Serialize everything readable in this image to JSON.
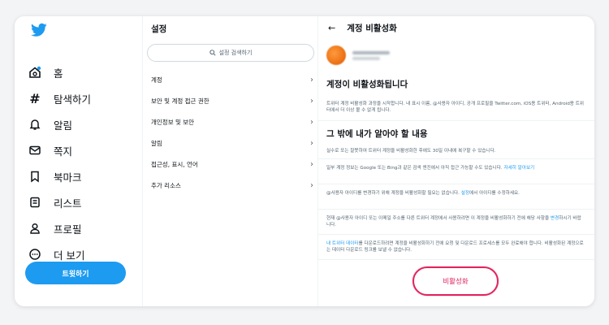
{
  "nav": {
    "items": [
      {
        "name": "home",
        "label": "홈",
        "icon": "home-icon"
      },
      {
        "name": "explore",
        "label": "탐색하기",
        "icon": "hashtag-icon"
      },
      {
        "name": "notifications",
        "label": "알림",
        "icon": "bell-icon"
      },
      {
        "name": "messages",
        "label": "쪽지",
        "icon": "envelope-icon"
      },
      {
        "name": "bookmarks",
        "label": "북마크",
        "icon": "bookmark-icon"
      },
      {
        "name": "lists",
        "label": "리스트",
        "icon": "list-icon"
      },
      {
        "name": "profile",
        "label": "프로필",
        "icon": "person-icon"
      },
      {
        "name": "more",
        "label": "더 보기",
        "icon": "more-icon"
      }
    ],
    "tweet_label": "트윗하기"
  },
  "settings": {
    "title": "설정",
    "search_placeholder": "설정 검색하기",
    "items": [
      {
        "label": "계정"
      },
      {
        "label": "보안 및 계정 접근 권한"
      },
      {
        "label": "개인정보 및 보안"
      },
      {
        "label": "알림"
      },
      {
        "label": "접근성, 표시, 언어"
      },
      {
        "label": "추가 리소스"
      }
    ]
  },
  "detail": {
    "title": "계정 비활성화",
    "heading1": "계정이 비활성화됩니다",
    "para1": "트위터 계정 비활성화 과정을 시작합니다. 내 표시 이름, @사용자 아이디, 공개 프로필을 Twitter.com, iOS용 트위터, Android용 트위터에서 더 이상 볼 수 없게 됩니다.",
    "heading2": "그 밖에 내가 알아야 할 내용",
    "p1": "실수로 또는 잘못하여 트위터 계정을 비활성화한 후에도 30일 이내에 복구할 수 있습니다.",
    "p2": "일부 계정 정보는 Google 또는 Bing과 같은 검색 엔진에서 아직 접근 가능할 수도 있습니다.",
    "p2_link": "자세히 알아보기",
    "p3_a": "@사용자 아이디를 변경하기 위해 계정을 비활성화할 필요는 없습니다.",
    "p3_link": "설정",
    "p3_b": "에서 아이디를 수정하세요.",
    "p4_a": "현재 @사용자 아이디 또는 이메일 주소를 다른 트위터 계정에서 사용하려면 이 계정을 비활성화하기 전에 해당 사항을",
    "p4_link": "변경",
    "p4_b": "하시기 바랍니다.",
    "p5_link": "내 트위터 데이터",
    "p5_b": "를 다운로드하려면 계정을 비활성화하기 전에 요청 및 다운로드 프로세스를 모두 완료해야 합니다. 비활성화된 계정으로는 데이터 다운로드 링크를 보낼 수 없습니다.",
    "deactivate_label": "비활성화"
  },
  "colors": {
    "brand": "#1d9bf0",
    "danger": "#e0245e"
  }
}
